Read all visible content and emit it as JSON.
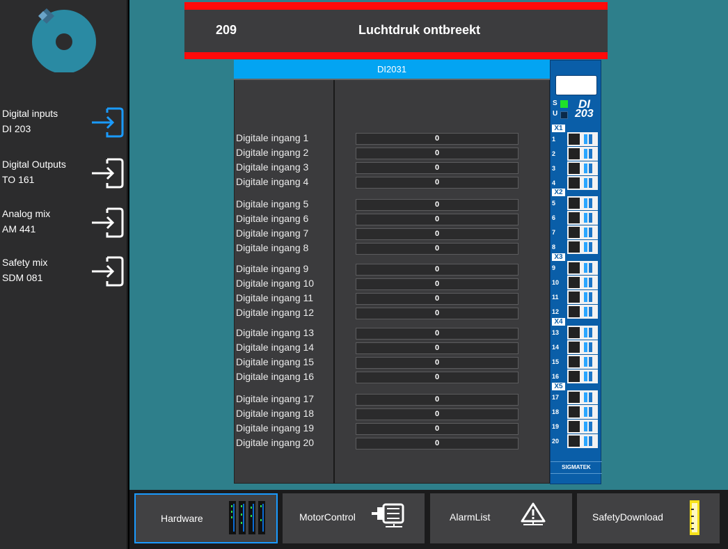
{
  "alarm": {
    "code": "209",
    "message": "Luchtdruk ontbreekt"
  },
  "sidebar": {
    "items": [
      {
        "line1": "Digital inputs",
        "line2": "DI 203",
        "active": true
      },
      {
        "line1": "Digital Outputs",
        "line2": "TO 161",
        "active": false
      },
      {
        "line1": "Analog mix",
        "line2": "AM 441",
        "active": false
      },
      {
        "line1": "Safety mix",
        "line2": "SDM 081",
        "active": false
      }
    ]
  },
  "panel": {
    "title": "DI2031",
    "inputs": [
      {
        "label": "Digitale ingang 1",
        "value": "0"
      },
      {
        "label": "Digitale ingang 2",
        "value": "0"
      },
      {
        "label": "Digitale ingang 3",
        "value": "0"
      },
      {
        "label": "Digitale ingang 4",
        "value": "0"
      },
      {
        "label": "Digitale ingang 5",
        "value": "0"
      },
      {
        "label": "Digitale ingang 6",
        "value": "0"
      },
      {
        "label": "Digitale ingang 7",
        "value": "0"
      },
      {
        "label": "Digitale ingang 8",
        "value": "0"
      },
      {
        "label": "Digitale ingang 9",
        "value": "0"
      },
      {
        "label": "Digitale ingang 10",
        "value": "0"
      },
      {
        "label": "Digitale ingang 11",
        "value": "0"
      },
      {
        "label": "Digitale ingang 12",
        "value": "0"
      },
      {
        "label": "Digitale ingang 13",
        "value": "0"
      },
      {
        "label": "Digitale ingang 14",
        "value": "0"
      },
      {
        "label": "Digitale ingang 15",
        "value": "0"
      },
      {
        "label": "Digitale ingang 16",
        "value": "0"
      },
      {
        "label": "Digitale ingang 17",
        "value": "0"
      },
      {
        "label": "Digitale ingang 18",
        "value": "0"
      },
      {
        "label": "Digitale ingang 19",
        "value": "0"
      },
      {
        "label": "Digitale ingang 20",
        "value": "0"
      }
    ]
  },
  "module": {
    "status_s": "S",
    "status_u": "U",
    "model_line1": "DI",
    "model_line2": "203",
    "connectors": [
      "X1",
      "X2",
      "X3",
      "X4",
      "X5"
    ],
    "pins": [
      "1",
      "2",
      "3",
      "4",
      "5",
      "6",
      "7",
      "8",
      "9",
      "10",
      "11",
      "12",
      "13",
      "14",
      "15",
      "16",
      "17",
      "18",
      "19",
      "20"
    ],
    "brand": "SIGMATEK",
    "led_s_color": "#1fe02a"
  },
  "tabs": [
    {
      "label": "Hardware",
      "icon": "hardware-icon",
      "active": true
    },
    {
      "label": "MotorControl",
      "icon": "motor-icon",
      "active": false
    },
    {
      "label": "AlarmList",
      "icon": "alarm-warning-icon",
      "active": false
    },
    {
      "label": "SafetyDownload",
      "icon": "safety-download-icon",
      "active": false
    }
  ],
  "colors": {
    "accent": "#03a4f2",
    "alarm": "#ff0a0a",
    "background": "#2e7f8b"
  }
}
